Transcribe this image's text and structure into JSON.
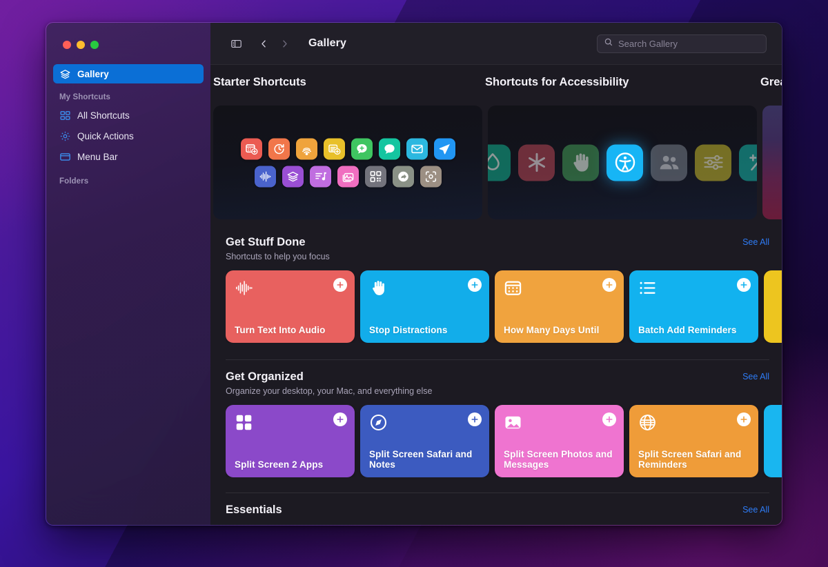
{
  "window": {
    "title": "Gallery",
    "traffic_lights": [
      "close",
      "minimize",
      "zoom"
    ]
  },
  "toolbar": {
    "sidebar_toggle_icon": "sidebar-toggle-icon",
    "back_icon": "chevron-left-icon",
    "forward_icon": "chevron-right-icon",
    "title": "Gallery",
    "search": {
      "icon": "search-icon",
      "placeholder": "Search Gallery",
      "value": ""
    }
  },
  "sidebar": {
    "gallery": {
      "label": "Gallery",
      "icon": "layers-icon",
      "selected": true
    },
    "section_my_shortcuts": "My Shortcuts",
    "items": [
      {
        "label": "All Shortcuts",
        "icon": "grid-icon"
      },
      {
        "label": "Quick Actions",
        "icon": "gear-icon"
      },
      {
        "label": "Menu Bar",
        "icon": "menubar-icon"
      }
    ],
    "section_folders": "Folders"
  },
  "banners": [
    {
      "title": "Starter Shortcuts",
      "kind": "icon-grid",
      "row1": [
        {
          "name": "calendar-add-icon",
          "color": "#eb5b52"
        },
        {
          "name": "timer-icon",
          "color": "#f1764a"
        },
        {
          "name": "airdrop-icon",
          "color": "#efa33c"
        },
        {
          "name": "note-add-icon",
          "color": "#e8c02a"
        },
        {
          "name": "message-add-icon",
          "color": "#3fc561"
        },
        {
          "name": "message-icon",
          "color": "#15c5a0"
        },
        {
          "name": "mail-icon",
          "color": "#2cb8e0"
        },
        {
          "name": "send-icon",
          "color": "#2196f3"
        }
      ],
      "row2": [
        {
          "name": "waveform-icon",
          "color": "#4a63cc"
        },
        {
          "name": "layers-icon",
          "color": "#9a4fd4"
        },
        {
          "name": "music-note-icon",
          "color": "#c06de0"
        },
        {
          "name": "photos-icon",
          "color": "#f06ec0"
        },
        {
          "name": "qr-code-icon",
          "color": "#73737c"
        },
        {
          "name": "share-icon",
          "color": "#8a9186"
        },
        {
          "name": "screenshot-icon",
          "color": "#9c8f83"
        }
      ]
    },
    {
      "title": "Shortcuts for Accessibility",
      "kind": "accessibility-row",
      "icons": [
        {
          "name": "droplet-icon",
          "color": "#12a084",
          "featured": false
        },
        {
          "name": "asterisk-icon",
          "color": "#a8414f",
          "featured": false
        },
        {
          "name": "hand-raised-icon",
          "color": "#3f8f52",
          "featured": false
        },
        {
          "name": "accessibility-icon",
          "color": "#17b5f5",
          "featured": true
        },
        {
          "name": "people-icon",
          "color": "#6f7480",
          "featured": false
        },
        {
          "name": "sliders-icon",
          "color": "#b5a82a",
          "featured": false
        },
        {
          "name": "plus-minus-icon",
          "color": "#16a59a",
          "featured": false
        }
      ]
    },
    {
      "title": "Great Shortcuts",
      "kind": "gradient",
      "clipped": true
    }
  ],
  "sections": [
    {
      "title": "Get Stuff Done",
      "subtitle": "Shortcuts to help you focus",
      "see_all": "See All",
      "divider": false,
      "cards": [
        {
          "title": "Turn Text Into Audio",
          "color": "#e8615f",
          "icon": "waveform-icon",
          "add": "plus-icon"
        },
        {
          "title": "Stop Distractions",
          "color": "#12adea",
          "icon": "hand-raised-icon",
          "add": "plus-icon"
        },
        {
          "title": "How Many Days Until",
          "color": "#f0a33e",
          "icon": "calendar-icon",
          "add": "plus-icon"
        },
        {
          "title": "Batch Add Reminders",
          "color": "#12b2ef",
          "icon": "list-bullet-icon",
          "add": "plus-icon"
        },
        {
          "title": "",
          "color": "#edc51f",
          "icon": "",
          "add": "plus-icon",
          "clipped": true
        }
      ]
    },
    {
      "title": "Get Organized",
      "subtitle": "Organize your desktop, your Mac, and everything else",
      "see_all": "See All",
      "divider": true,
      "cards": [
        {
          "title": "Split Screen 2 Apps",
          "color": "#8b49c9",
          "icon": "squares-grid-icon",
          "add": "plus-icon"
        },
        {
          "title": "Split Screen Safari and Notes",
          "color": "#3c5bc0",
          "icon": "compass-icon",
          "add": "plus-icon"
        },
        {
          "title": "Split Screen Photos and Messages",
          "color": "#ef74d0",
          "icon": "photo-icon",
          "add": "plus-icon"
        },
        {
          "title": "Split Screen Safari and Reminders",
          "color": "#ef9c39",
          "icon": "globe-icon",
          "add": "plus-icon"
        },
        {
          "title": "",
          "color": "#19b6f0",
          "icon": "",
          "add": "plus-icon",
          "clipped": true
        }
      ]
    }
  ],
  "bottom_section": {
    "title": "Essentials",
    "see_all": "See All",
    "divider": true
  },
  "colors": {
    "accent": "#2e7cf6",
    "sidebar_selection": "#0b6fd6",
    "window_bg": "#1c1a22",
    "toolbar_bg": "#211f28"
  }
}
